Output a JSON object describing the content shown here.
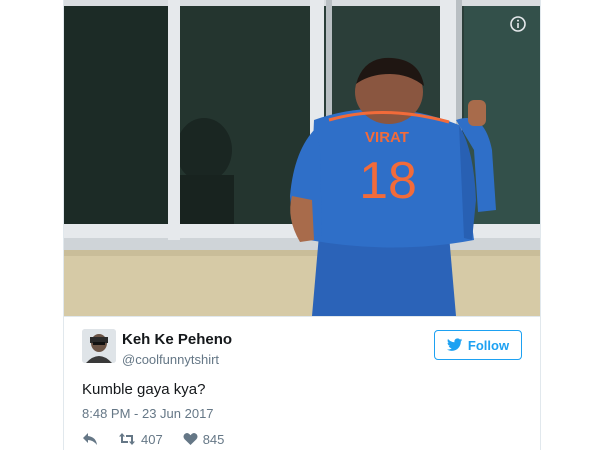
{
  "tweet": {
    "display_name": "Keh Ke Peheno",
    "handle": "@coolfunnytshirt",
    "follow_label": "Follow",
    "text": "Kumble gaya kya?",
    "timestamp": "8:48 PM - 23 Jun 2017",
    "retweets": "407",
    "likes": "845"
  },
  "photo": {
    "jersey_name": "VIRAT",
    "jersey_number": "18"
  },
  "colors": {
    "accent": "#1da1f2",
    "jersey": "#2f6fc8",
    "jersey_text": "#f26b3a",
    "wall": "#d6caa6",
    "window_frame": "#e6e9ec",
    "secondary_text": "#657786"
  },
  "icons": [
    "info-icon",
    "twitter-bird-icon",
    "reply-icon",
    "retweet-icon",
    "heart-icon"
  ]
}
